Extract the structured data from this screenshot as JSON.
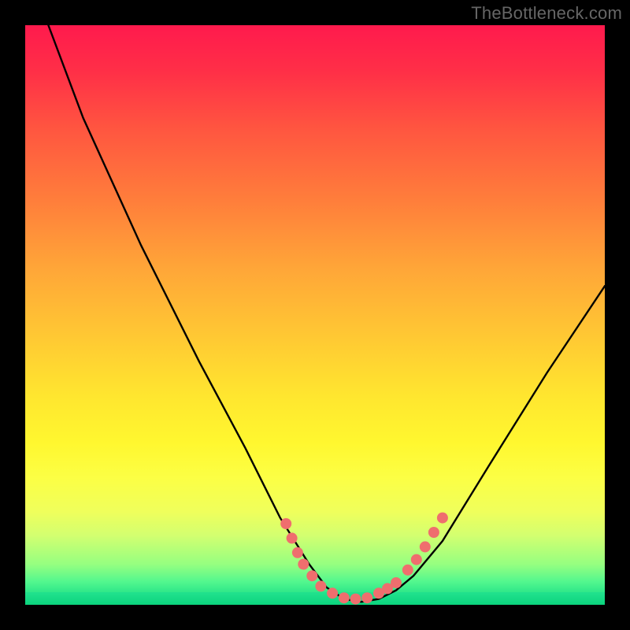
{
  "watermark": "TheBottleneck.com",
  "chart_data": {
    "type": "line",
    "title": "",
    "xlabel": "",
    "ylabel": "",
    "xlim": [
      0,
      100
    ],
    "ylim": [
      0,
      100
    ],
    "series": [
      {
        "name": "bottleneck-curve",
        "x": [
          4,
          10,
          20,
          30,
          38,
          44,
          49,
          52,
          55,
          58,
          61,
          64,
          67,
          72,
          80,
          90,
          100
        ],
        "y": [
          100,
          84,
          62,
          42,
          27,
          15,
          7,
          3,
          1,
          0.5,
          1,
          2.5,
          5,
          11,
          24,
          40,
          55
        ]
      }
    ],
    "markers": {
      "name": "highlight-dots",
      "color": "#ef6e6e",
      "points_xy": [
        [
          45,
          14
        ],
        [
          46,
          11.5
        ],
        [
          47,
          9
        ],
        [
          48,
          7
        ],
        [
          49.5,
          5
        ],
        [
          51,
          3.2
        ],
        [
          53,
          2
        ],
        [
          55,
          1.2
        ],
        [
          57,
          1
        ],
        [
          59,
          1.2
        ],
        [
          61,
          2
        ],
        [
          62.5,
          2.8
        ],
        [
          64,
          3.8
        ],
        [
          66,
          6
        ],
        [
          67.5,
          7.8
        ],
        [
          69,
          10
        ],
        [
          70.5,
          12.5
        ],
        [
          72,
          15
        ]
      ]
    },
    "gradient_stops": [
      {
        "pos": 0,
        "color": "#ff1a4d"
      },
      {
        "pos": 68,
        "color": "#fff72f"
      },
      {
        "pos": 100,
        "color": "#0fd680"
      }
    ]
  }
}
